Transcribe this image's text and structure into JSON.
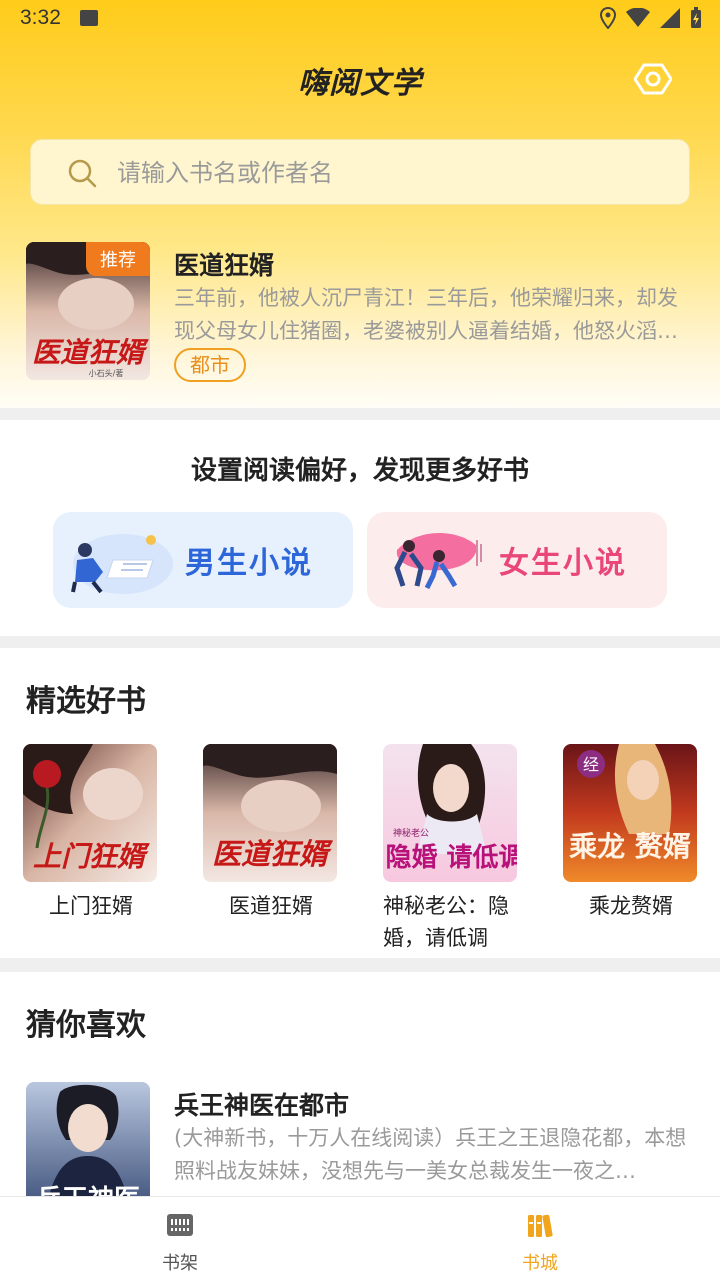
{
  "status": {
    "time": "3:32"
  },
  "app": {
    "title": "嗨阅文学"
  },
  "search": {
    "placeholder": "请输入书名或作者名"
  },
  "recommend": {
    "tag": "推荐",
    "title": "医道狂婿",
    "description": "三年前，他被人沉尸青江！三年后，他荣耀归来，却发现父母女儿住猪圈，老婆被别人逼着结婚，他怒火滔天，誓要让所有人付出代价！",
    "category": "都市",
    "cover_text": "医道狂婿",
    "cover_sub": "小石头/著"
  },
  "preferences": {
    "title": "设置阅读偏好，发现更多好书",
    "male_label": "男生小说",
    "female_label": "女生小说"
  },
  "picks": {
    "title": "精选好书",
    "books": [
      {
        "name": "上门狂婿",
        "cover_text": "上门狂婿"
      },
      {
        "name": "医道狂婿",
        "cover_text": "医道狂婿"
      },
      {
        "name": "神秘老公：隐婚，请低调",
        "cover_text": "隐婚 请低调",
        "cover_sub": "神秘老公"
      },
      {
        "name": "乘龙赘婿",
        "cover_text": "乘龙 赘婿",
        "cover_sub": "经"
      }
    ]
  },
  "guess": {
    "title": "猜你喜欢",
    "book": {
      "title": "兵王神医在都市",
      "description": "(大神新书，十万人在线阅读）兵王之王退隐花都，本想照料战友妹妹，没想先与一美女总裁发生一夜之…",
      "cover_text": "兵王神医"
    }
  },
  "nav": {
    "shelf_label": "书架",
    "store_label": "书城"
  },
  "colors": {
    "accent": "#ffcc1a",
    "nav_active": "#f0a51c",
    "tag": "#f07a1e"
  }
}
